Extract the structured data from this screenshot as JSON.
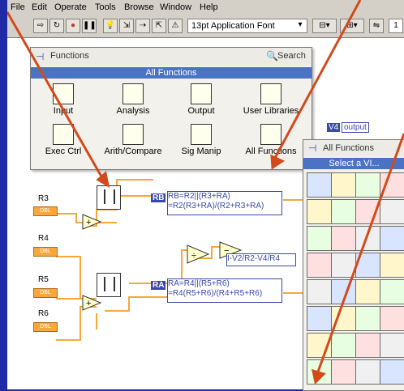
{
  "menu": [
    "File",
    "Edit",
    "Operate",
    "Tools",
    "Browse",
    "Window",
    "Help"
  ],
  "toolbar": {
    "font": "13pt Application Font",
    "counter": "1"
  },
  "functions_palette": {
    "title": "Functions",
    "search": "Search",
    "header": "All Functions",
    "categories": [
      "Input",
      "Analysis",
      "Output",
      "User Libraries",
      "Exec Ctrl",
      "Arith/Compare",
      "Sig Manip",
      "All Functions"
    ]
  },
  "subpalette": {
    "title": "All Functions",
    "header": "Select a VI..."
  },
  "diagram": {
    "inputs": [
      "R3",
      "R4",
      "R5",
      "R6"
    ],
    "dbl": "DBL",
    "formula_rb": {
      "label": "RB",
      "lines": [
        "RB=R2||(R3+RA)",
        "=R2(R3+RA)/(R2+R3+RA)"
      ]
    },
    "formula_ra": {
      "label": "RA",
      "lines": [
        "RA=R4||(R5+R6)",
        "=R4(R5+R6)/(R4+R5+R6)"
      ]
    },
    "formula_i": "I-V2/R2-V4/R4",
    "indicator": {
      "label": "V4",
      "value": "output"
    }
  },
  "colors": {
    "background": "#1f2aa6",
    "accent_blue": "#4b73c4",
    "wire_orange": "#f7a73c",
    "arrow": "#d24a1c"
  }
}
